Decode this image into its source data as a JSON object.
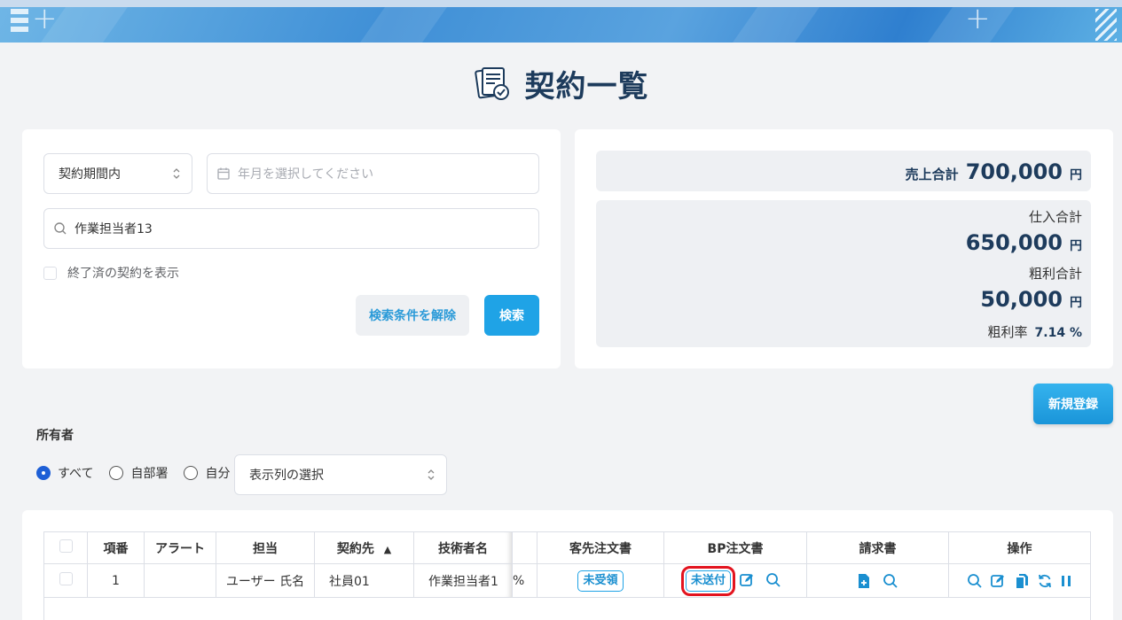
{
  "header": {
    "title": "契約一覧"
  },
  "search": {
    "period_select": "契約期間内",
    "date_placeholder": "年月を選択してください",
    "worker_value": "作業担当者13",
    "show_finished_label": "終了済の契約を表示",
    "clear_button": "検索条件を解除",
    "search_button": "検索"
  },
  "summary": {
    "sales_label": "売上合計",
    "sales_value": "700,000",
    "purchase_label": "仕入合計",
    "purchase_value": "650,000",
    "profit_label": "粗利合計",
    "profit_value": "50,000",
    "margin_label": "粗利率",
    "margin_value": "7.14 %",
    "currency": "円"
  },
  "actions": {
    "new_button": "新規登録"
  },
  "owner": {
    "label": "所有者",
    "options": [
      "すべて",
      "自部署",
      "自分"
    ],
    "selected": "すべて",
    "column_select": "表示列の選択"
  },
  "table": {
    "columns": [
      "項番",
      "アラート",
      "担当",
      "契約先",
      "技術者名",
      "客先注文書",
      "BP注文書",
      "請求書",
      "操作"
    ],
    "sort_indicator": "▲",
    "rows": [
      {
        "no": "1",
        "alert": "",
        "owner": "ユーザー 氏名",
        "client": "社員01",
        "engineer": "作業担当者1",
        "hidden_col": "%",
        "customer_order": "未受領",
        "bp_order": "未送付"
      }
    ]
  },
  "colors": {
    "accent": "#1fa3e6",
    "title": "#1d3b5c",
    "highlight": "#e3141f"
  }
}
